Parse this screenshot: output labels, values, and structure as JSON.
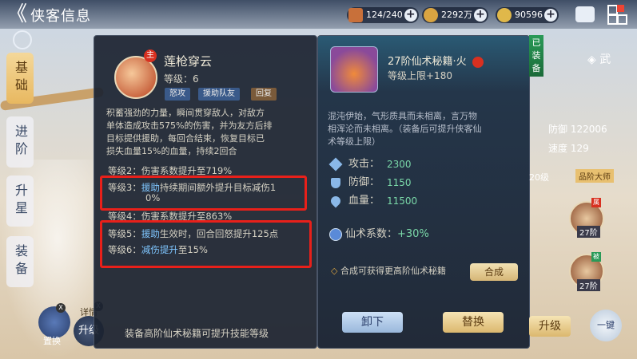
{
  "header": {
    "back_label": "《",
    "title": "侠客信息"
  },
  "resources": [
    {
      "name": "chest",
      "value": "124/240",
      "color": "#c8703a"
    },
    {
      "name": "coin",
      "value": "2292万",
      "color": "#d9a441"
    },
    {
      "name": "gem",
      "value": "90596",
      "color": "#e0b84a"
    }
  ],
  "side_tabs": [
    "基础",
    "进阶",
    "升星",
    "装备"
  ],
  "skill": {
    "badge": "主",
    "name": "莲枪穿云",
    "level_label": "等级：6",
    "tags": [
      "怒攻",
      "援助队友",
      "回复"
    ],
    "desc_lines": [
      "积蓄强劲的力量，瞬间贯穿敌人，对敌方",
      "单体造成攻击575%的伤害，并为友方后排",
      "目标提供援助，每回合结束，恢复目标已",
      "损失血量15%的血量，持续2回合"
    ],
    "levels": {
      "l2": "等级2：伤害系数提升至719%",
      "l3_a": "等级3：",
      "l3_b": "援助",
      "l3_c": "持续期间额外提升目标减伤1",
      "l3_d": "0%",
      "l4": "等级4：伤害系数提升至863%",
      "l5_a": "等级5：",
      "l5_b": "援助",
      "l5_c": "生效时，回合回怒提升125点",
      "l6_a": "等级6：",
      "l6_b": "减伤提升",
      "l6_c": "至15%"
    },
    "footer": "装备高阶仙术秘籍可提升技能等级"
  },
  "book": {
    "title": "27阶仙术秘籍·火",
    "level_cap": "等级上限+180",
    "equipped": "已装备",
    "desc_lines": [
      "混沌伊始，气形质具而未相离，言万物",
      "相浑沦而未相离。（装备后可提升侠客仙",
      "术等级上限）"
    ],
    "stats": [
      {
        "label": "攻击：",
        "value": "2300"
      },
      {
        "label": "防御：",
        "value": "1150"
      },
      {
        "label": "血量：",
        "value": "11500"
      }
    ],
    "skill_coef_label": "仙术系数：",
    "skill_coef_value": "+30%",
    "compose_hint": "合成可获得更高阶仙术秘籍",
    "compose_btn": "合成",
    "unequip_btn": "卸下",
    "replace_btn": "替换"
  },
  "right_side": {
    "wu": "武",
    "defense": "防御 122006",
    "speed": "速度 129",
    "grade": "品阶大师",
    "lvl": "20级",
    "hero1_badge": "属",
    "hero1_lvl": "27阶",
    "hero2_badge": "被",
    "hero2_lvl": "27阶",
    "upgrade": "升级",
    "onekey": "一键"
  },
  "bottom_left": {
    "zhi_huan": "置换",
    "x1": "X",
    "x2": "X",
    "upgrade": "升级",
    "detail": "详情"
  }
}
